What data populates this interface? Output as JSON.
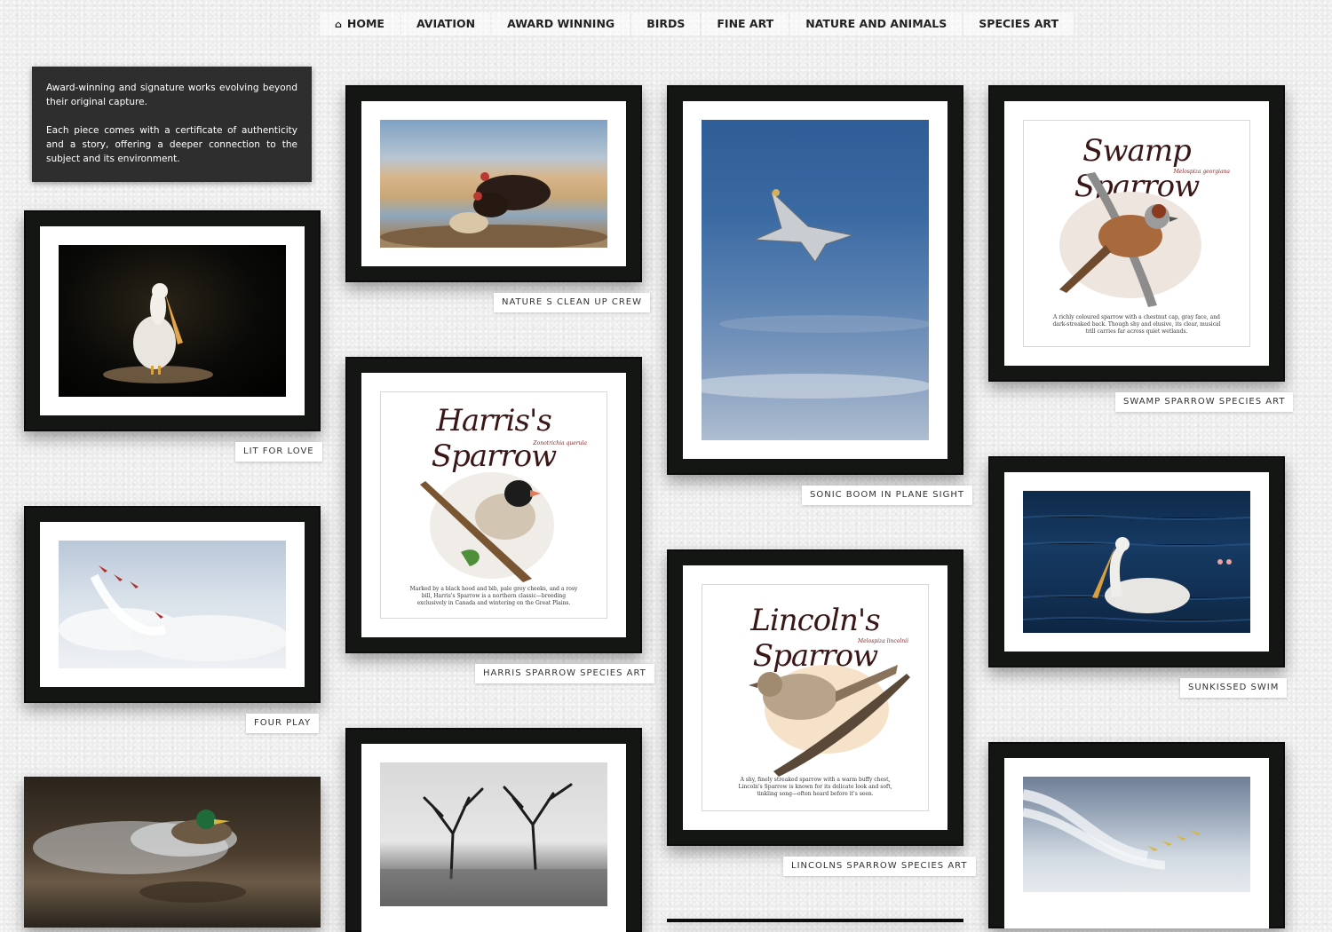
{
  "nav": {
    "home": "HOME",
    "items": [
      "AVIATION",
      "AWARD WINNING",
      "BIRDS",
      "FINE ART",
      "NATURE AND ANIMALS",
      "SPECIES ART"
    ]
  },
  "intro": {
    "paragraph1": "Award-winning and signature works evolving beyond their original capture.",
    "paragraph2": "Each piece comes with a certificate of authenticity and a story, offering a deeper connection to the subject and its environment."
  },
  "gallery": {
    "lit_for_love": "LIT FOR LOVE",
    "four_play": "FOUR PLAY",
    "nature_clean_up": "NATURE S CLEAN UP CREW",
    "harris_sparrow": "HARRIS SPARROW SPECIES ART",
    "sonic_boom": "SONIC BOOM IN PLANE SIGHT",
    "lincolns_sparrow": "LINCOLNS SPARROW SPECIES ART",
    "swamp_sparrow": "SWAMP SPARROW SPECIES ART",
    "sunkissed_swim": "SUNKISSED SWIM"
  },
  "species": {
    "swamp": {
      "title": "Swamp Sparrow",
      "latin": "Melospiza georgiana",
      "text": "A richly coloured sparrow with a chestnut cap, gray face, and dark-streaked back. Though shy and elusive, its clear, musical trill carries far across quiet wetlands."
    },
    "harris": {
      "title": "Harris's Sparrow",
      "latin": "Zonotrichia querula",
      "text": "Marked by a black hood and bib, pale grey cheeks, and a rosy bill, Harris's Sparrow is a northern classic—breeding exclusively in Canada and wintering on the Great Plains."
    },
    "lincoln": {
      "title": "Lincoln's Sparrow",
      "latin": "Melospiza lincolnii",
      "text": "A shy, finely streaked sparrow with a warm buffy chest, Lincoln's Sparrow is known for its delicate look and soft, tinkling song—often heard before it's seen."
    }
  }
}
